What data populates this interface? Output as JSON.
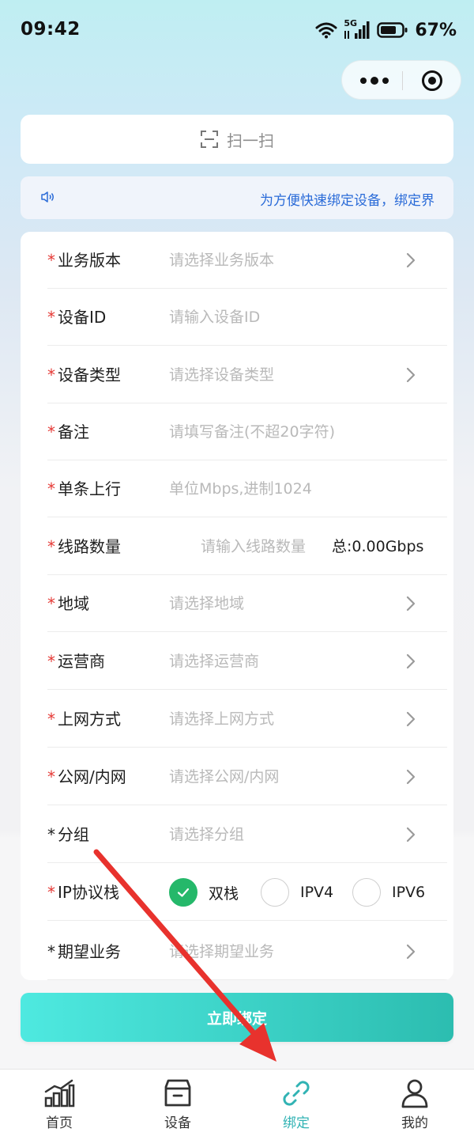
{
  "status_bar": {
    "time": "09:42",
    "network": "5G",
    "battery": "67%"
  },
  "scan": {
    "label": "扫一扫"
  },
  "notice": {
    "text": "为方便快速绑定设备，绑定界"
  },
  "form": {
    "business_version": {
      "label": "业务版本",
      "placeholder": "请选择业务版本"
    },
    "device_id": {
      "label": "设备ID",
      "placeholder": "请输入设备ID"
    },
    "device_type": {
      "label": "设备类型",
      "placeholder": "请选择设备类型"
    },
    "remark": {
      "label": "备注",
      "placeholder": "请填写备注(不超20字符)"
    },
    "uplink": {
      "label": "单条上行",
      "placeholder": "单位Mbps,进制1024"
    },
    "line_count": {
      "label": "线路数量",
      "placeholder": "请输入线路数量",
      "total": "总:0.00Gbps"
    },
    "region": {
      "label": "地域",
      "placeholder": "请选择地域"
    },
    "isp": {
      "label": "运营商",
      "placeholder": "请选择运营商"
    },
    "access_mode": {
      "label": "上网方式",
      "placeholder": "请选择上网方式"
    },
    "network_type": {
      "label": "公网/内网",
      "placeholder": "请选择公网/内网"
    },
    "group": {
      "label": "分组",
      "placeholder": "请选择分组"
    },
    "ip_stack": {
      "label": "IP协议栈",
      "options": [
        "双栈",
        "IPV4",
        "IPV6"
      ],
      "selected": "双栈"
    },
    "expected_business": {
      "label": "期望业务",
      "placeholder": "请选择期望业务"
    }
  },
  "submit_label": "立即绑定",
  "tabs": [
    {
      "label": "首页"
    },
    {
      "label": "设备"
    },
    {
      "label": "绑定"
    },
    {
      "label": "我的"
    }
  ],
  "colors": {
    "accent": "#31b3b4",
    "required": "#e53935",
    "radio_checked": "#25b86a",
    "notice_text": "#2a6bd8",
    "annotation_arrow": "#e8322d"
  }
}
